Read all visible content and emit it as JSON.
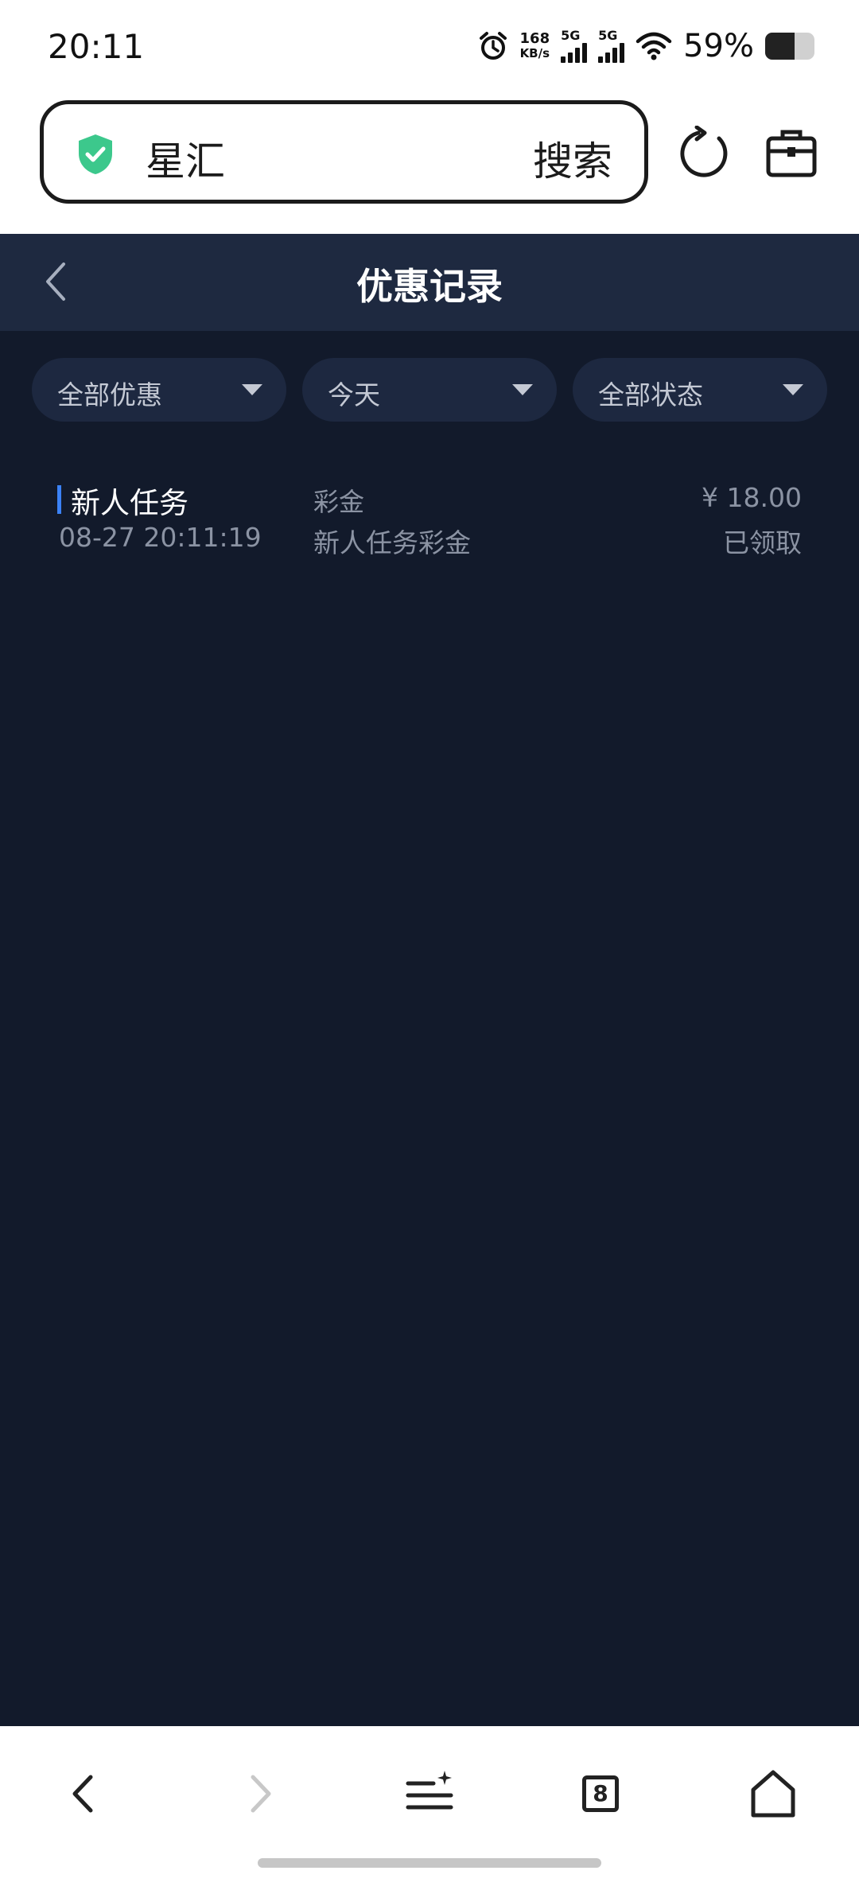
{
  "status_bar": {
    "time": "20:11",
    "net_speed_value": "168",
    "net_speed_unit": "KB/s",
    "sim1_label": "5G",
    "sim2_label": "5G",
    "battery_percent": "59%",
    "battery_level": 0.59
  },
  "browser": {
    "site_name": "星汇",
    "search_label": "搜索",
    "tab_count": "8"
  },
  "header": {
    "title": "优惠记录"
  },
  "filters": [
    {
      "label": "全部优惠"
    },
    {
      "label": "今天"
    },
    {
      "label": "全部状态"
    }
  ],
  "records": [
    {
      "title": "新人任务",
      "time": "08-27 20:11:19",
      "type": "彩金",
      "description": "新人任务彩金",
      "amount": "¥ 18.00",
      "status": "已领取"
    }
  ],
  "colors": {
    "page_bg": "#121a2b",
    "header_bg": "#1e2940",
    "filter_bg": "#1d2840",
    "accent": "#3b82f6",
    "shield_green": "#3cc88c"
  }
}
